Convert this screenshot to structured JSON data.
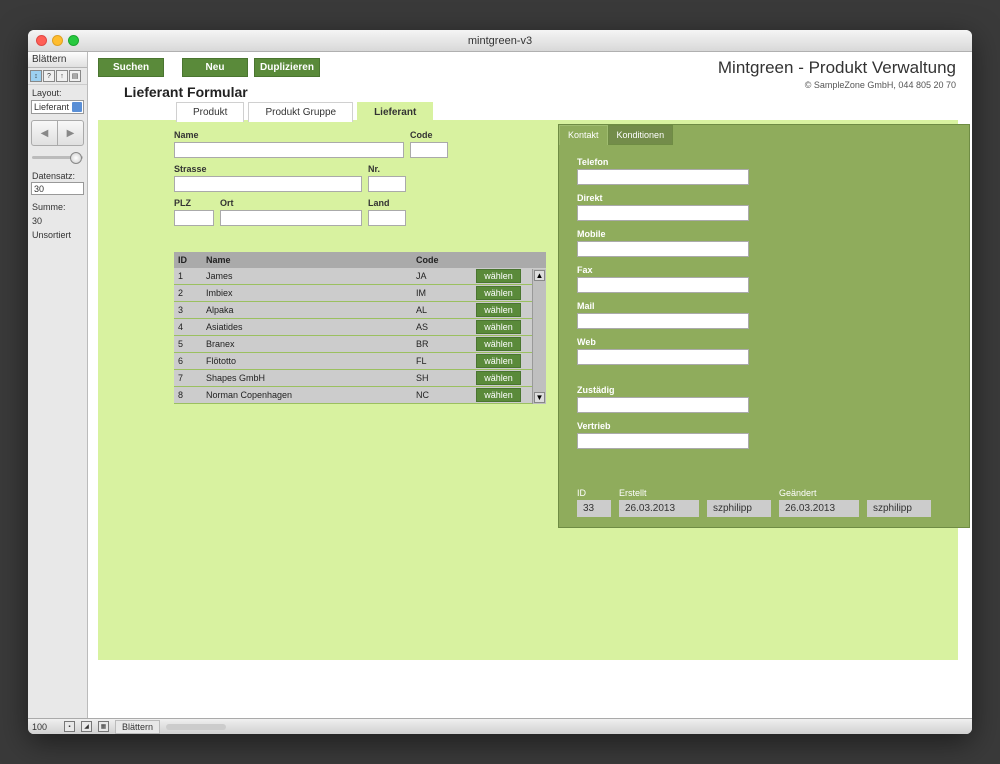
{
  "window": {
    "title": "mintgreen-v3"
  },
  "sidebar": {
    "mode_top": "Blättern",
    "layout_label": "Layout:",
    "layout_value": "Lieferant",
    "record_label": "Datensatz:",
    "record_value": "30",
    "total_label": "Summe:",
    "total_value": "30",
    "sort_status": "Unsortiert"
  },
  "app": {
    "title": "Mintgreen - Produkt Verwaltung",
    "copyright": "© SampleZone GmbH, 044 805 20 70"
  },
  "toolbar": {
    "search": "Suchen",
    "new": "Neu",
    "duplicate": "Duplizieren"
  },
  "form": {
    "title": "Lieferant Formular",
    "tabs": [
      "Produkt",
      "Produkt Gruppe",
      "Lieferant"
    ],
    "active_tab": 2,
    "labels": {
      "name": "Name",
      "code": "Code",
      "strasse": "Strasse",
      "nr": "Nr.",
      "plz": "PLZ",
      "ort": "Ort",
      "land": "Land"
    }
  },
  "list": {
    "headers": {
      "id": "ID",
      "name": "Name",
      "code": "Code"
    },
    "select_label": "wählen",
    "rows": [
      {
        "id": "1",
        "name": "James",
        "code": "JA"
      },
      {
        "id": "2",
        "name": "Imbiex",
        "code": "IM"
      },
      {
        "id": "3",
        "name": "Alpaka",
        "code": "AL"
      },
      {
        "id": "4",
        "name": "Asiatides",
        "code": "AS"
      },
      {
        "id": "5",
        "name": "Branex",
        "code": "BR"
      },
      {
        "id": "6",
        "name": "Flötotto",
        "code": "FL"
      },
      {
        "id": "7",
        "name": "Shapes GmbH",
        "code": "SH"
      },
      {
        "id": "8",
        "name": "Norman Copenhagen",
        "code": "NC"
      }
    ]
  },
  "detail": {
    "tabs": [
      "Kontakt",
      "Konditionen"
    ],
    "active_tab": 0,
    "fields": {
      "telefon": "Telefon",
      "direkt": "Direkt",
      "mobile": "Mobile",
      "fax": "Fax",
      "mail": "Mail",
      "web": "Web",
      "zustandig": "Zustädig",
      "vertrieb": "Vertrieb"
    },
    "footer": {
      "id_label": "ID",
      "id_value": "33",
      "erstellt_label": "Erstellt",
      "erstellt_date": "26.03.2013",
      "erstellt_user": "szphilipp",
      "geandert_label": "Geändert",
      "geandert_date": "26.03.2013",
      "geandert_user": "szphilipp"
    }
  },
  "statusbar": {
    "zoom": "100",
    "mode": "Blättern"
  }
}
